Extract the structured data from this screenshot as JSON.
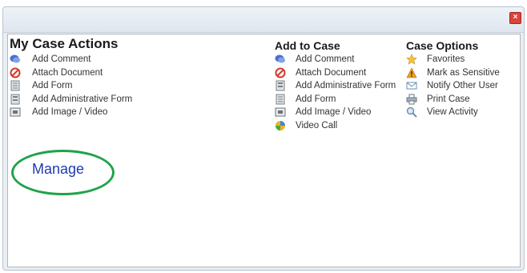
{
  "window": {
    "close_icon": "close-icon",
    "accent": "#d9453b"
  },
  "my_case_actions": {
    "title": "My Case Actions",
    "items": [
      {
        "label": "Add Comment",
        "icon": "comment-icon"
      },
      {
        "label": "Attach Document",
        "icon": "attach-icon"
      },
      {
        "label": "Add Form",
        "icon": "form-icon"
      },
      {
        "label": "Add Administrative Form",
        "icon": "admin-form-icon"
      },
      {
        "label": "Add Image / Video",
        "icon": "image-icon"
      }
    ],
    "manage_label": "Manage"
  },
  "add_to_case": {
    "title": "Add to Case",
    "items": [
      {
        "label": "Add Comment",
        "icon": "comment-icon"
      },
      {
        "label": "Attach Document",
        "icon": "attach-icon"
      },
      {
        "label": "Add Administrative Form",
        "icon": "admin-form-icon"
      },
      {
        "label": "Add Form",
        "icon": "form-icon"
      },
      {
        "label": "Add Image / Video",
        "icon": "image-icon"
      },
      {
        "label": "Video Call",
        "icon": "video-call-icon"
      }
    ]
  },
  "case_options": {
    "title": "Case Options",
    "items": [
      {
        "label": "Favorites",
        "icon": "star-icon"
      },
      {
        "label": "Mark as Sensitive",
        "icon": "warning-icon"
      },
      {
        "label": "Notify Other User",
        "icon": "envelope-icon"
      },
      {
        "label": "Print Case",
        "icon": "printer-icon"
      },
      {
        "label": "View Activity",
        "icon": "magnifier-icon"
      }
    ]
  },
  "highlight_color": "#21a24a"
}
